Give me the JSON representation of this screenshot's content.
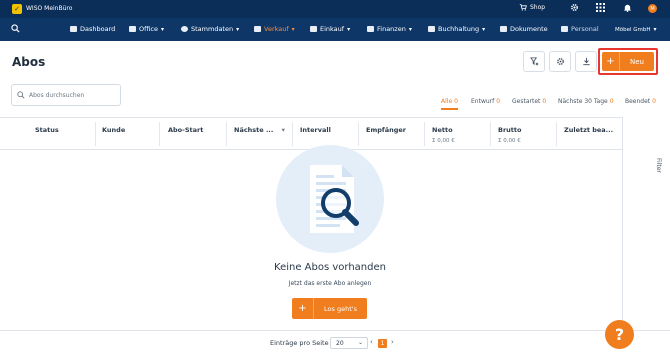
{
  "topbar": {
    "app_name": "WISO MeinBüro",
    "shop_label": "Shop",
    "avatar_initial": "M"
  },
  "nav": {
    "items": [
      {
        "label": "Dashboard"
      },
      {
        "label": "Office"
      },
      {
        "label": "Stammdaten"
      },
      {
        "label": "Verkauf"
      },
      {
        "label": "Einkauf"
      },
      {
        "label": "Finanzen"
      },
      {
        "label": "Buchhaltung"
      },
      {
        "label": "Dokumente"
      },
      {
        "label": "Personal"
      }
    ],
    "active": "Verkauf",
    "company": "Möbel GmbH"
  },
  "page": {
    "title": "Abos",
    "new_button": "Neu"
  },
  "search": {
    "placeholder": "Abos durchsuchen",
    "value": ""
  },
  "filter_tabs": [
    {
      "label": "Alle",
      "count": "0"
    },
    {
      "label": "Entwurf",
      "count": "0"
    },
    {
      "label": "Gestartet",
      "count": "0"
    },
    {
      "label": "Nächste 30 Tage",
      "count": "0"
    },
    {
      "label": "Beendet",
      "count": "0"
    }
  ],
  "table": {
    "columns": [
      {
        "label": "Status"
      },
      {
        "label": "Kunde"
      },
      {
        "label": "Abo-Start"
      },
      {
        "label": "Nächste ..."
      },
      {
        "label": "Intervall"
      },
      {
        "label": "Empfänger"
      },
      {
        "label": "Netto",
        "sum": "Σ 0,00 €"
      },
      {
        "label": "Brutto",
        "sum": "Σ 0,00 €"
      },
      {
        "label": "Zuletzt bea..."
      }
    ]
  },
  "side_panel_label": "Filter",
  "empty_state": {
    "title": "Keine Abos vorhanden",
    "subtitle": "Jetzt das erste Abo anlegen",
    "button": "Los geht's"
  },
  "pagination": {
    "per_page_label": "Einträge pro Seite",
    "per_page_value": "20",
    "current_page": "1"
  },
  "help_label": "?",
  "colors": {
    "topbar": "#0b2e59",
    "navbar": "#0e3768",
    "accent": "#f07d1e",
    "highlight_border": "#e8362f"
  }
}
